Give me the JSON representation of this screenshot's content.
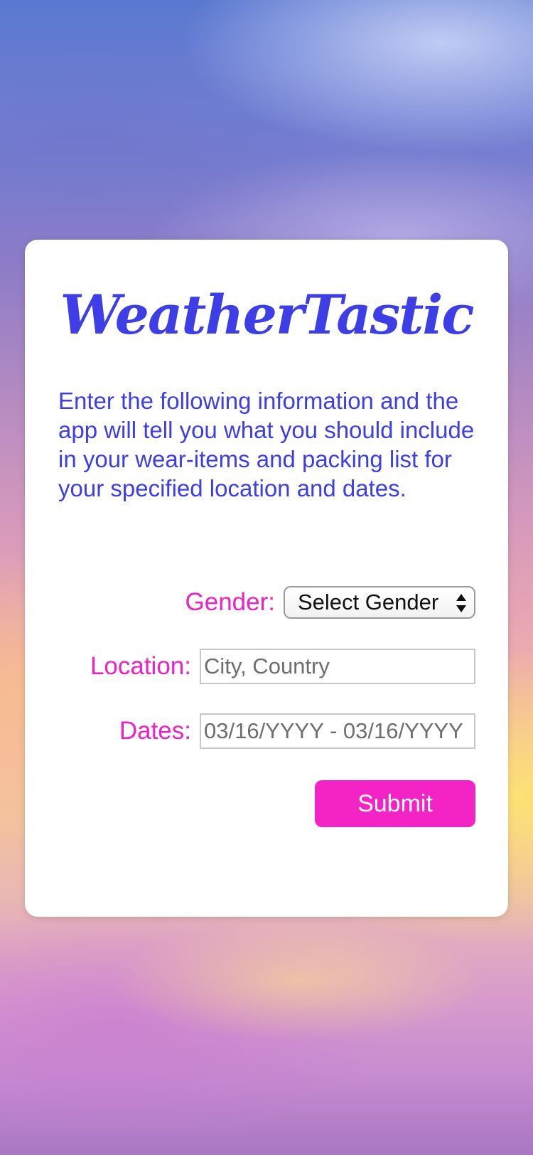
{
  "app": {
    "title": "WeatherTastic"
  },
  "intro": {
    "text": "Enter the following information and the app will tell you what you should include in your wear-items and packing list for your specified location and dates."
  },
  "form": {
    "gender_label": "Gender:",
    "gender_value": "Select Gender",
    "location_label": "Location:",
    "location_placeholder": "City, Country",
    "dates_label": "Dates:",
    "dates_value": "03/16/YYYY - 03/16/YYYY",
    "submit_label": "Submit"
  },
  "colors": {
    "brand": "#3d3ee6",
    "label": "#ec22c4",
    "button": "#f423c5"
  },
  "icons": {
    "select_arrows": "chevron-updown-icon"
  }
}
